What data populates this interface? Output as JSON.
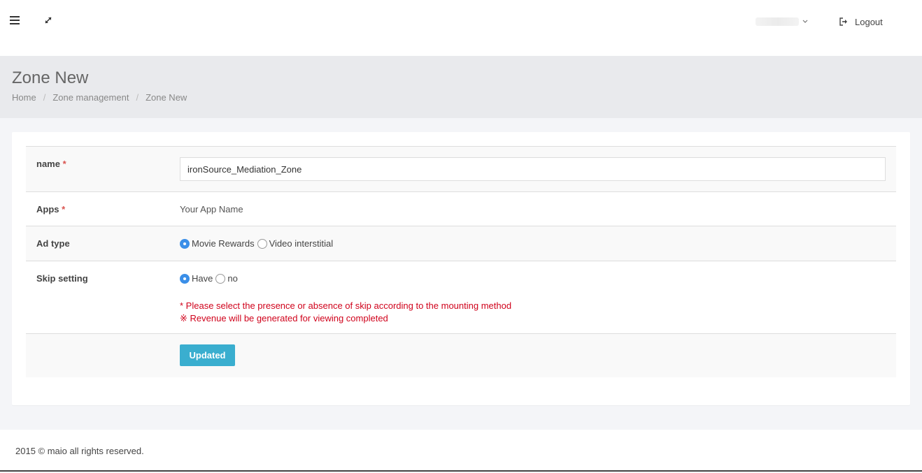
{
  "topbar": {
    "menu_icon": "hamburger-icon",
    "expand_icon": "expand-icon",
    "user_dropdown_icon": "chevron-down-icon",
    "logout_icon": "sign-out-icon",
    "logout_label": "Logout"
  },
  "header": {
    "title": "Zone New",
    "breadcrumb": [
      "Home",
      "Zone management",
      "Zone New"
    ]
  },
  "form": {
    "name": {
      "label": "name",
      "required_mark": "*",
      "value": "ironSource_Mediation_Zone"
    },
    "apps": {
      "label": "Apps",
      "required_mark": "*",
      "value": "Your App Name"
    },
    "ad_type": {
      "label": "Ad type",
      "options": [
        "Movie Rewards",
        "Video interstitial"
      ],
      "selected": "Movie Rewards"
    },
    "skip_setting": {
      "label": "Skip setting",
      "options": [
        "Have",
        "no"
      ],
      "selected": "Have",
      "notes": [
        "* Please select the presence or absence of skip according to the mounting method",
        "※ Revenue will be generated for viewing completed"
      ]
    },
    "submit_label": "Updated"
  },
  "colors": {
    "primary_button": "#3aaecf",
    "radio_checked": "#3b8fe8",
    "required": "#d9534f",
    "note_text": "#d0021b",
    "header_bg": "#e9eaed"
  },
  "footer": {
    "text": "2015 © maio all rights reserved."
  }
}
